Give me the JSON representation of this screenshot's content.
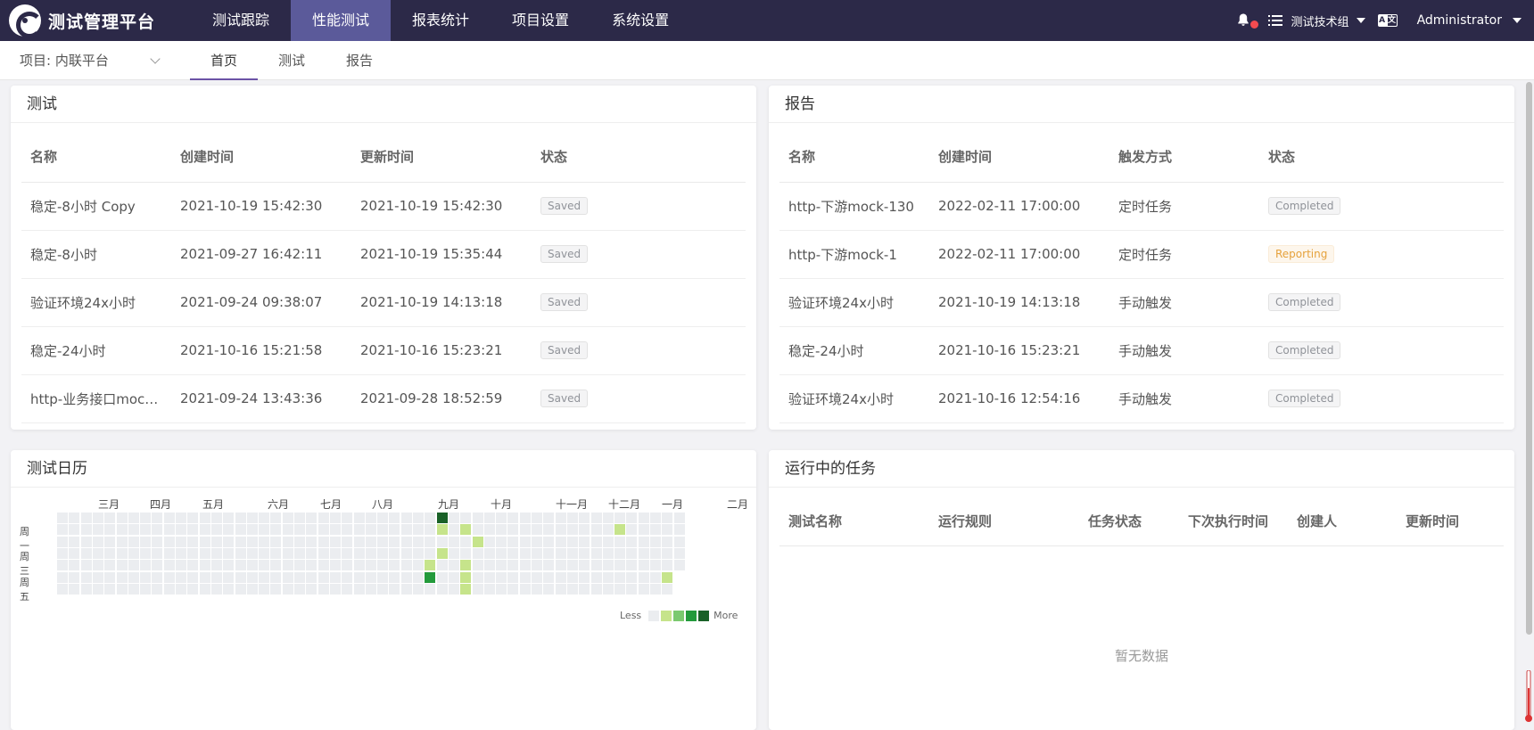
{
  "app": {
    "title": "测试管理平台"
  },
  "topnav": [
    {
      "label": "测试跟踪",
      "active": false
    },
    {
      "label": "性能测试",
      "active": true
    },
    {
      "label": "报表统计",
      "active": false
    },
    {
      "label": "项目设置",
      "active": false
    },
    {
      "label": "系统设置",
      "active": false
    }
  ],
  "topright": {
    "group": "测试技术组",
    "user": "Administrator",
    "lang_icon": [
      "A",
      "文"
    ],
    "icons": [
      "bell-icon",
      "notification-dot",
      "task-list-icon",
      "language-icon",
      "caret-down-icon"
    ]
  },
  "subbar": {
    "project": "项目: 内联平台",
    "tabs": [
      {
        "label": "首页",
        "active": true
      },
      {
        "label": "测试",
        "active": false
      },
      {
        "label": "报告",
        "active": false
      }
    ]
  },
  "tests_card": {
    "title": "测试",
    "columns": [
      "名称",
      "创建时间",
      "更新时间",
      "状态"
    ],
    "rows": [
      [
        "稳定-8小时 Copy",
        "2021-10-19 15:42:30",
        "2021-10-19 15:42:30",
        "Saved"
      ],
      [
        "稳定-8小时",
        "2021-09-27 16:42:11",
        "2021-10-19 15:35:44",
        "Saved"
      ],
      [
        "验证环境24x小时",
        "2021-09-24 09:38:07",
        "2021-10-19 14:13:18",
        "Saved"
      ],
      [
        "稳定-24小时",
        "2021-10-16 15:21:58",
        "2021-10-16 15:23:21",
        "Saved"
      ],
      [
        "http-业务接口moc…",
        "2021-09-24 13:43:36",
        "2021-09-28 18:52:59",
        "Saved"
      ]
    ]
  },
  "reports_card": {
    "title": "报告",
    "columns": [
      "名称",
      "创建时间",
      "触发方式",
      "状态"
    ],
    "rows": [
      [
        "http-下游mock-130",
        "2022-02-11 17:00:00",
        "定时任务",
        "Completed"
      ],
      [
        "http-下游mock-1",
        "2022-02-11 17:00:00",
        "定时任务",
        "Reporting"
      ],
      [
        "验证环境24x小时",
        "2021-10-19 14:13:18",
        "手动触发",
        "Completed"
      ],
      [
        "稳定-24小时",
        "2021-10-16 15:23:21",
        "手动触发",
        "Completed"
      ],
      [
        "验证环境24x小时",
        "2021-10-16 12:54:16",
        "手动触发",
        "Completed"
      ]
    ]
  },
  "calendar_card": {
    "title": "测试日历",
    "months": [
      "三月",
      "四月",
      "五月",
      "六月",
      "七月",
      "八月",
      "九月",
      "十月",
      "十一月",
      "十二月",
      "一月",
      "二月"
    ],
    "day_labels": [
      "周一",
      "周三",
      "周五"
    ],
    "legend_less": "Less",
    "legend_more": "More",
    "colors": [
      "#ebedf0",
      "#c6e48b",
      "#7bc96f",
      "#239a3b",
      "#196127"
    ],
    "active_cells": [
      {
        "week": 32,
        "day": 0,
        "level": 4
      },
      {
        "week": 32,
        "day": 1,
        "level": 1
      },
      {
        "week": 34,
        "day": 1,
        "level": 1
      },
      {
        "week": 35,
        "day": 2,
        "level": 1
      },
      {
        "week": 32,
        "day": 3,
        "level": 1
      },
      {
        "week": 31,
        "day": 4,
        "level": 1
      },
      {
        "week": 34,
        "day": 4,
        "level": 1
      },
      {
        "week": 31,
        "day": 5,
        "level": 3
      },
      {
        "week": 34,
        "day": 5,
        "level": 1
      },
      {
        "week": 34,
        "day": 6,
        "level": 1
      },
      {
        "week": 47,
        "day": 1,
        "level": 1
      },
      {
        "week": 51,
        "day": 5,
        "level": 1
      }
    ]
  },
  "tasks_card": {
    "title": "运行中的任务",
    "columns": [
      "测试名称",
      "运行规则",
      "任务状态",
      "下次执行时间",
      "创建人",
      "更新时间"
    ],
    "empty_text": "暂无数据"
  }
}
